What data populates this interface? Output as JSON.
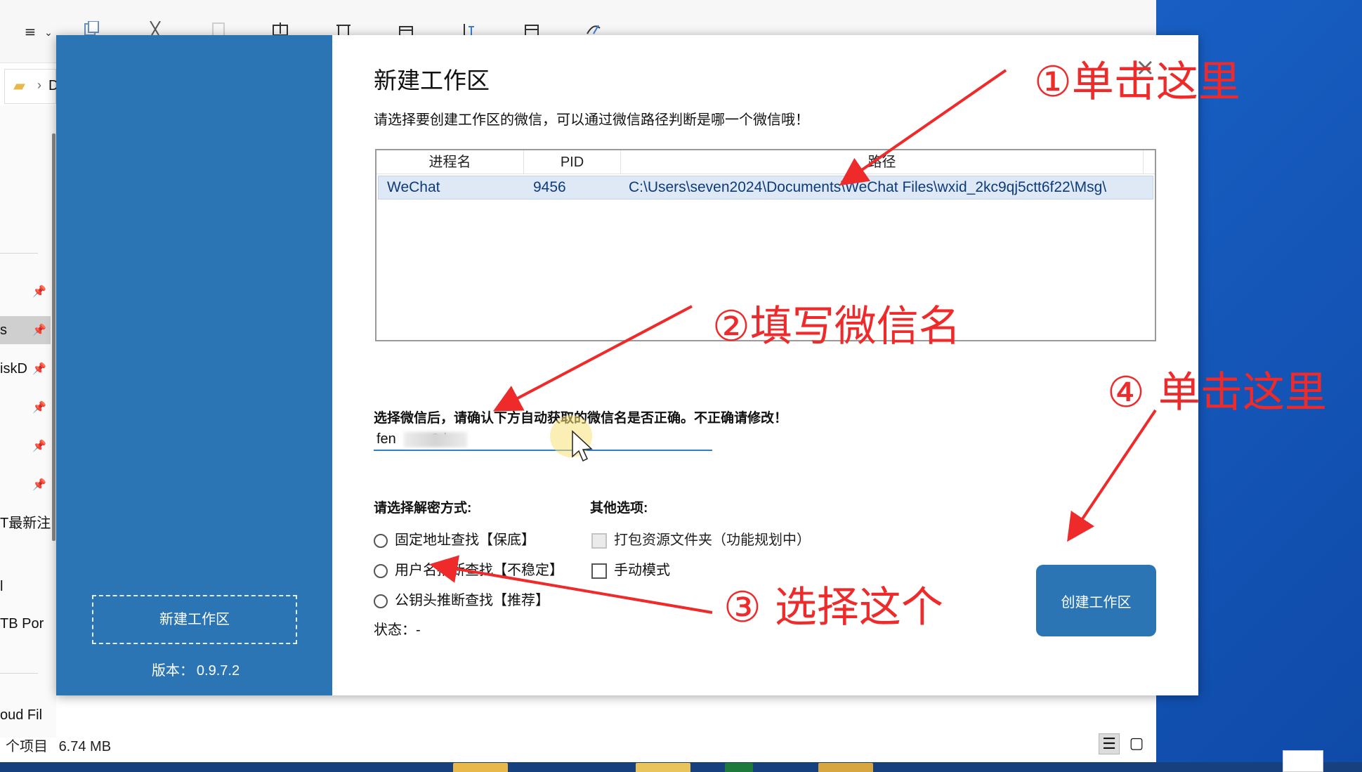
{
  "explorer": {
    "toolbar_icons": [
      "menu-icon",
      "copy-icon",
      "cut-icon",
      "paste-icon",
      "rename-icon",
      "delete-icon",
      "share-icon",
      "sort-icon",
      "view-icon",
      "filter-icon"
    ],
    "menu_glyph": "≡",
    "chevron_glyph": "⌄",
    "folder_glyph": "▰",
    "path_separator": "›",
    "path_fragment": "D",
    "pin_glyph": "📌",
    "sidebar_items": [
      {
        "label": ""
      },
      {
        "label": "s"
      },
      {
        "label": "iskD"
      },
      {
        "label": ""
      },
      {
        "label": ""
      },
      {
        "label": ""
      },
      {
        "label": "T最新注"
      },
      {
        "label": "l"
      },
      {
        "label": "TB Por"
      },
      {
        "label": "oud Fil"
      }
    ],
    "status_items": "个项目",
    "status_size": "6.74 MB",
    "details_view_glyph": "☰",
    "large_view_glyph": "▢"
  },
  "dialog": {
    "side_button": "新建工作区",
    "version_label": "版本：",
    "version_value": "0.9.7.2",
    "title": "新建工作区",
    "close_glyph": "×",
    "description": "请选择要创建工作区的微信，可以通过微信路径判断是哪一个微信哦！",
    "table": {
      "columns": [
        "进程名",
        "PID",
        "路径"
      ],
      "rows": [
        {
          "name": "WeChat",
          "pid": "9456",
          "path": "C:\\Users\\seven2024\\Documents\\WeChat Files\\wxid_2kc9qj5ctt6f22\\Msg\\"
        }
      ]
    },
    "confirm_label": "选择微信后，请确认下方自动获取的微信名是否正确。不正确请修改！",
    "wechat_name_value": "fen         8d",
    "method_label": "请选择解密方式:",
    "methods": [
      "固定地址查找【保底】",
      "用户名推断查找【不稳定】",
      "公钥头推断查找【推荐】"
    ],
    "other_label": "其他选项:",
    "other_options": [
      {
        "label": "打包资源文件夹（功能规划中）",
        "disabled": true
      },
      {
        "label": "手动模式",
        "disabled": false
      }
    ],
    "status_label": "状态：",
    "status_value": "-",
    "create_button": "创建工作区"
  },
  "annotations": [
    {
      "text": "①单击这里"
    },
    {
      "text": "②填写微信名"
    },
    {
      "text": "③ 选择这个"
    },
    {
      "text": "④ 单击这里"
    }
  ],
  "colors": {
    "accent": "#2b75b5",
    "annotation": "#ee2a2a",
    "selected_row": "#dfe9f6",
    "desktop": "#1a63c9"
  }
}
